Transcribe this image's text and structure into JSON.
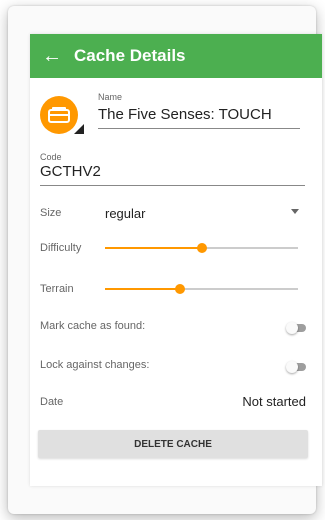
{
  "appbar": {
    "back_icon": "arrow-back-icon",
    "title": "Cache Details"
  },
  "cache": {
    "icon": "cache-type-icon",
    "name_label": "Name",
    "name": "The Five Senses: TOUCH",
    "code_label": "Code",
    "code": "GCTHV2"
  },
  "size": {
    "label": "Size",
    "value": "regular",
    "dropdown_icon": "dropdown-arrow-icon"
  },
  "difficulty": {
    "label": "Difficulty",
    "level": 0.5
  },
  "terrain": {
    "label": "Terrain",
    "level": 0.39
  },
  "found": {
    "label": "Mark cache as found:",
    "checked": false
  },
  "lock": {
    "label": "Lock against changes:",
    "checked": false
  },
  "date": {
    "label": "Date",
    "value": "Not started"
  },
  "delete_button": "DELETE CACHE",
  "colors": {
    "appbar": "#4caf50",
    "accent": "#ff9800",
    "toggle_off": "#9e9e9e"
  }
}
